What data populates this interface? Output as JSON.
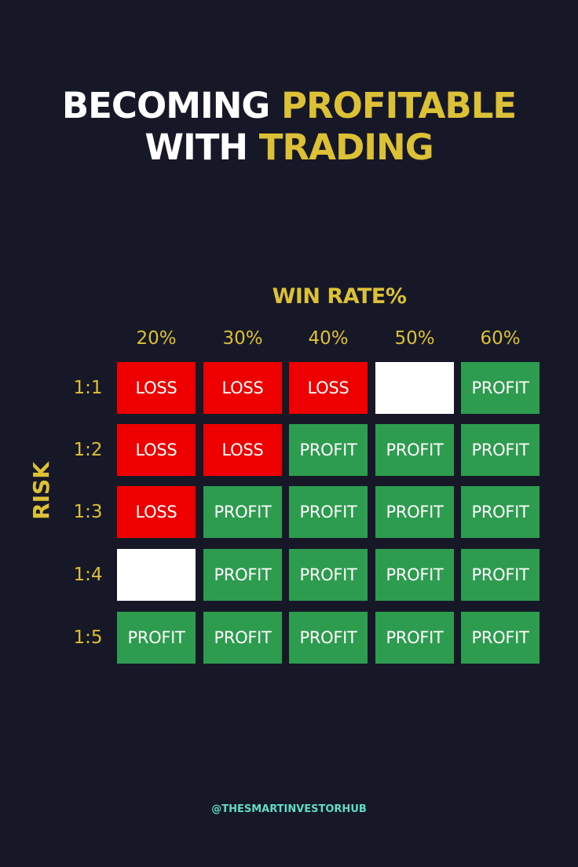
{
  "title": {
    "line1_white": "BECOMING",
    "line1_gold": "PROFITABLE",
    "line2_white": "WITH",
    "line2_gold": "TRADING"
  },
  "colors": {
    "background": "#161827",
    "gold": "#dcc035",
    "loss": "#ee0000",
    "profit": "#2e9c4e",
    "blank": "#ffffff",
    "footer": "#5fdcc4"
  },
  "chart_data": {
    "type": "table",
    "xlabel": "WIN RATE%",
    "ylabel": "RISK",
    "columns": [
      "20%",
      "30%",
      "40%",
      "50%",
      "60%"
    ],
    "rows": [
      {
        "label": "1:1",
        "cells": [
          "LOSS",
          "LOSS",
          "LOSS",
          "",
          "PROFIT"
        ]
      },
      {
        "label": "1:2",
        "cells": [
          "LOSS",
          "LOSS",
          "PROFIT",
          "PROFIT",
          "PROFIT"
        ]
      },
      {
        "label": "1:3",
        "cells": [
          "LOSS",
          "PROFIT",
          "PROFIT",
          "PROFIT",
          "PROFIT"
        ]
      },
      {
        "label": "1:4",
        "cells": [
          "",
          "PROFIT",
          "PROFIT",
          "PROFIT",
          "PROFIT"
        ]
      },
      {
        "label": "1:5",
        "cells": [
          "PROFIT",
          "PROFIT",
          "PROFIT",
          "PROFIT",
          "PROFIT"
        ]
      }
    ]
  },
  "footer": {
    "handle": "@THESMARTINVESTORHUB"
  }
}
